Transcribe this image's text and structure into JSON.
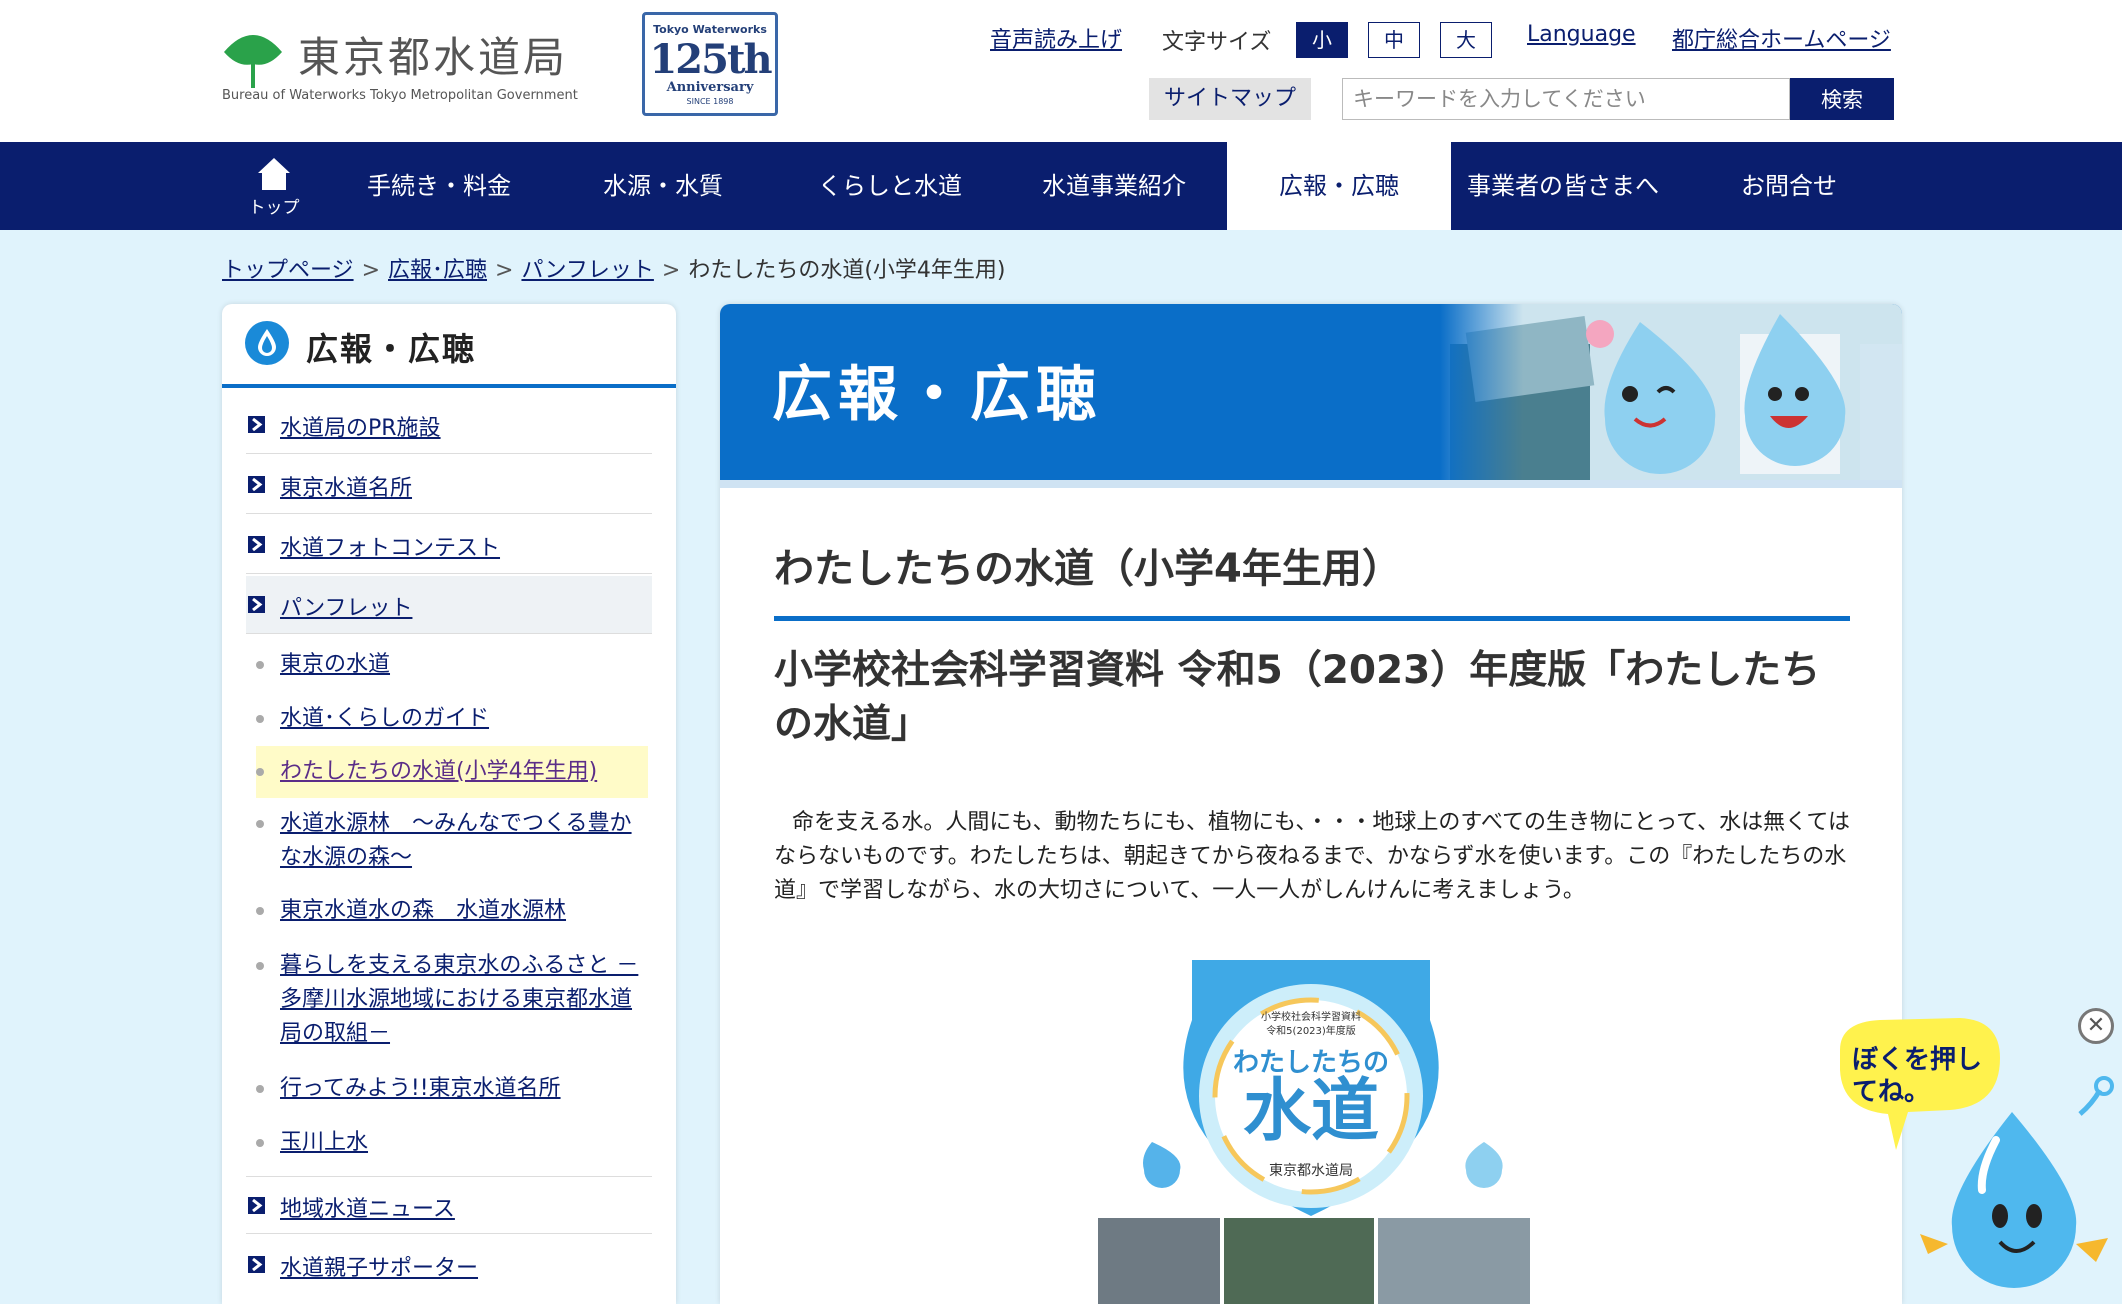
{
  "header": {
    "logo_title": "東京都水道局",
    "logo_subtitle": "Bureau of Waterworks Tokyo Metropolitan Government",
    "anniversary": {
      "line1": "Tokyo Waterworks",
      "line2": "125th",
      "line3": "Anniversary",
      "line4": "SINCE 1898"
    },
    "utility": {
      "speech": "音声読み上げ",
      "font_size_label": "文字サイズ",
      "small": "小",
      "medium": "中",
      "large": "大",
      "language": "Language",
      "metro_home": "都庁総合ホームページ"
    },
    "sitemap": "サイトマップ",
    "search": {
      "placeholder": "キーワードを入力してください",
      "button": "検索"
    }
  },
  "nav": {
    "home": "トップ",
    "items": [
      "手続き・料金",
      "水源・水質",
      "くらしと水道",
      "水道事業紹介",
      "広報・広聴",
      "事業者の皆さまへ",
      "お問合せ"
    ]
  },
  "breadcrumb": [
    "トップページ",
    "広報･広聴",
    "パンフレット",
    "わたしたちの水道(小学4年生用)"
  ],
  "sidebar": {
    "title": "広報・広聴",
    "items": [
      "水道局のPR施設",
      "東京水道名所",
      "水道フォトコンテスト",
      "パンフレット"
    ],
    "subitems": [
      "東京の水道",
      "水道･くらしのガイド",
      "わたしたちの水道(小学4年生用)",
      "水道水源林　～みんなでつくる豊かな水源の森～",
      "東京水道水の森　水道水源林",
      "暮らしを支える東京水のふるさと －多摩川水源地域における東京都水道局の取組－",
      "行ってみよう!!東京水道名所",
      "玉川上水"
    ],
    "items_after": [
      "地域水道ニュース",
      "水道親子サポーター"
    ]
  },
  "main": {
    "banner_title": "広報・広聴",
    "page_title": "わたしたちの水道（小学4年生用）",
    "section_title": "小学校社会科学習資料 令和5（2023）年度版「わたしたちの水道」",
    "lead": "命を支える水。人間にも、動物たちにも、植物にも、・・・地球上のすべての生き物にとって、水は無くてはならないものです。わたしたちは、朝起きてから夜ねるまで、かならず水を使います。この『わたしたちの水道』で学習しながら、水の大切さについて、一人一人がしんけんに考えましょう。",
    "cover": {
      "caption_small": "小学校社会科学習資料",
      "caption_year": "令和5(2023)年度版",
      "title_top": "わたしたちの",
      "title_big": "水道",
      "publisher": "東京都水道局"
    }
  },
  "mascot": {
    "bubble": "ぼくを押してね。"
  },
  "colors": {
    "navy": "#0a1e6e",
    "blue": "#0a6ec8",
    "page_bg": "#e0f3fc",
    "highlight": "#fffbc8"
  }
}
